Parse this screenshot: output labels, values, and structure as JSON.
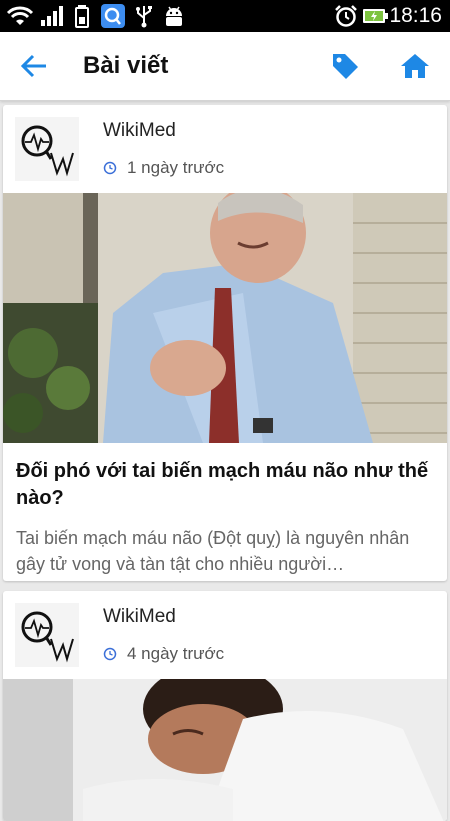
{
  "status_bar": {
    "time": "18:16",
    "icons": [
      "wifi-icon",
      "signal-icon",
      "battery-saver-icon",
      "search-app-icon",
      "usb-icon",
      "android-debug-icon",
      "alarm-icon",
      "battery-charging-icon"
    ]
  },
  "app_bar": {
    "title": "Bài viết",
    "back_icon": "arrow-back-icon",
    "tag_icon": "tag-icon",
    "home_icon": "home-icon",
    "accent_color": "#1e88e5"
  },
  "articles": [
    {
      "source": "WikiMed",
      "time": "1 ngày trước",
      "image": "man-clutching-chest-photo",
      "headline": "Đối phó với tai biến mạch máu não như thế nào?",
      "excerpt": "Tai biến mạch máu não (Đột quỵ) là nguyên nhân gây tử vong và tàn tật cho nhiều người…"
    },
    {
      "source": "WikiMed",
      "time": "4 ngày trước",
      "image": "man-in-pain-photo"
    }
  ]
}
